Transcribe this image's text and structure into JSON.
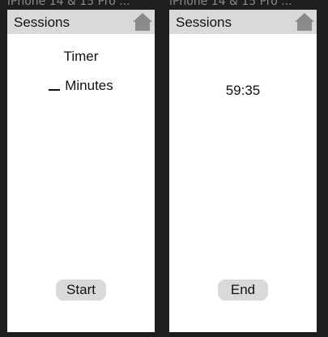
{
  "frames": [
    {
      "label": "iPhone 14 & 15 Pro ...",
      "header": {
        "title": "Sessions",
        "home_icon": "home-icon"
      },
      "timer_label": "Timer",
      "minutes_label": "Minutes",
      "start_label": "Start"
    },
    {
      "label": "iPhone 14 & 15 Pro ...",
      "header": {
        "title": "Sessions",
        "home_icon": "home-icon"
      },
      "countdown": "59:35",
      "end_label": "End"
    }
  ],
  "colors": {
    "background": "#1e1e1e",
    "screen": "#ffffff",
    "header_bar": "#d9d9d9",
    "home_icon": "#8a8a8a",
    "button": "#d9d9d9"
  }
}
